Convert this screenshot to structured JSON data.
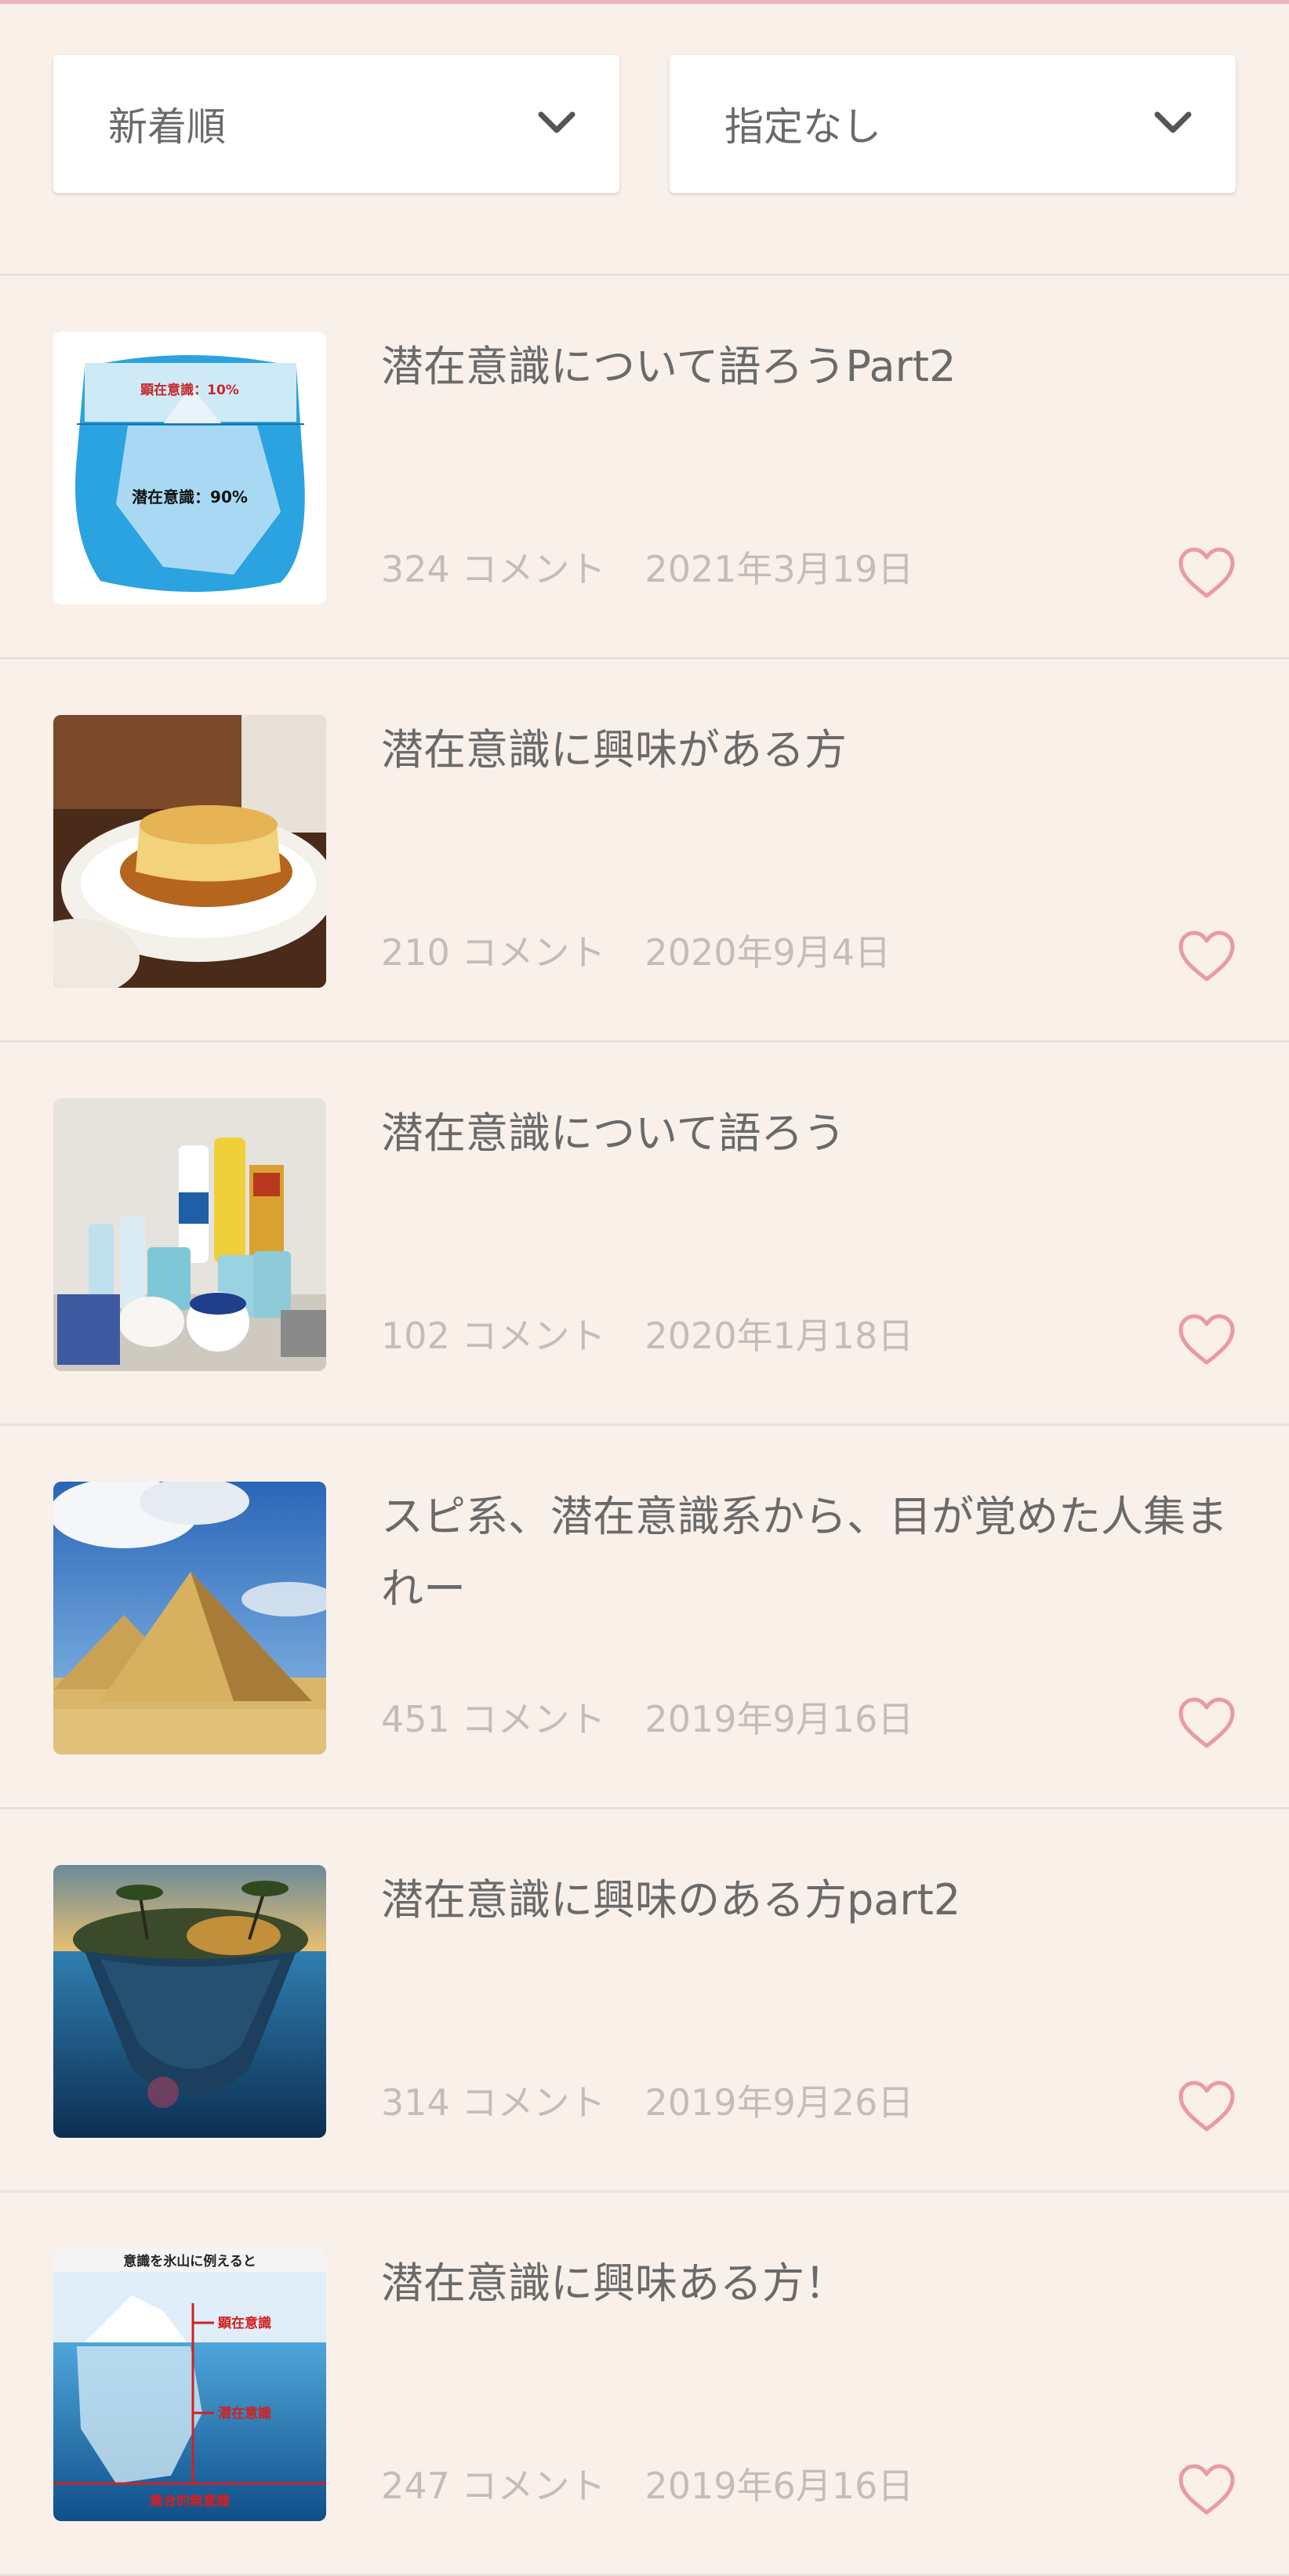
{
  "colors": {
    "background": "#f9f0ea",
    "heart": "#e99aa3",
    "text": "#6a6a6a",
    "meta": "#c3bdb9"
  },
  "filters": {
    "sort": {
      "label": "新着順",
      "icon": "chevron-down-icon"
    },
    "category": {
      "label": "指定なし",
      "icon": "chevron-down-icon"
    }
  },
  "topics": [
    {
      "title": "潜在意識について語ろうPart2",
      "comments": "324 コメント",
      "date": "2021年3月19日",
      "thumb_text_top": "顕在意識：10%",
      "thumb_text_bottom": "潜在意識：90%"
    },
    {
      "title": "潜在意識に興味がある方",
      "comments": "210 コメント",
      "date": "2020年9月4日"
    },
    {
      "title": "潜在意識について語ろう",
      "comments": "102 コメント",
      "date": "2020年1月18日"
    },
    {
      "title": "スピ系、潜在意識系から、目が覚めた人集まれー",
      "comments": "451 コメント",
      "date": "2019年9月16日"
    },
    {
      "title": "潜在意識に興味のある方part2",
      "comments": "314 コメント",
      "date": "2019年9月26日"
    },
    {
      "title": "潜在意識に興味ある方！",
      "comments": "247 コメント",
      "date": "2019年6月16日",
      "thumb_header": "意識を氷山に例えると",
      "thumb_label_1": "顕在意識",
      "thumb_label_2": "潜在意識",
      "thumb_label_3": "集合的無意識"
    }
  ]
}
